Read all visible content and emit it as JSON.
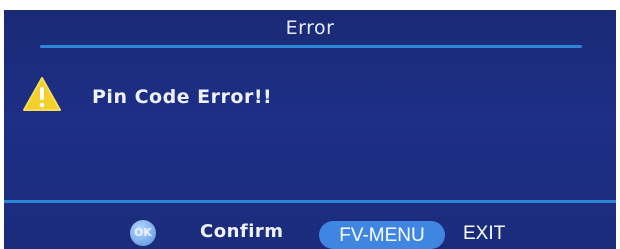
{
  "dialog": {
    "title": "Error",
    "message": "Pin Code Error!!",
    "icon": "warning-triangle-icon"
  },
  "footer": {
    "ok_icon_label": "OK",
    "confirm_label": "Confirm",
    "menu_button_label": "FV-MENU",
    "exit_label": "EXIT"
  },
  "colors": {
    "background": "#1d2f86",
    "accent_rule": "#2f86d8",
    "warning_yellow": "#f4cf2c",
    "menu_button": "#3f86e3"
  }
}
